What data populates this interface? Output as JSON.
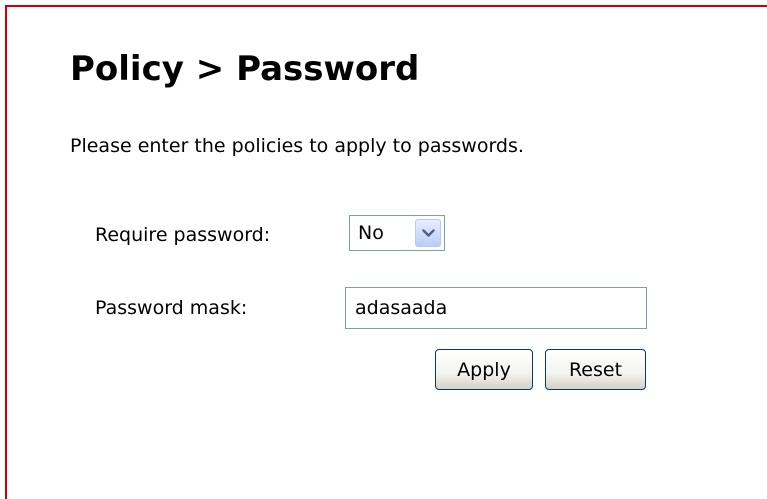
{
  "page": {
    "title": "Policy > Password",
    "intro": "Please enter the policies to apply to passwords."
  },
  "form": {
    "require_password": {
      "label": "Require password:",
      "selected": "No",
      "icon": "chevron-down-icon"
    },
    "password_mask": {
      "label": "Password mask:",
      "value": "adasaada"
    },
    "apply_label": "Apply",
    "reset_label": "Reset"
  },
  "colors": {
    "frame_border": "#cc0000",
    "input_border": "#7f9db9",
    "button_border": "#003c74"
  }
}
